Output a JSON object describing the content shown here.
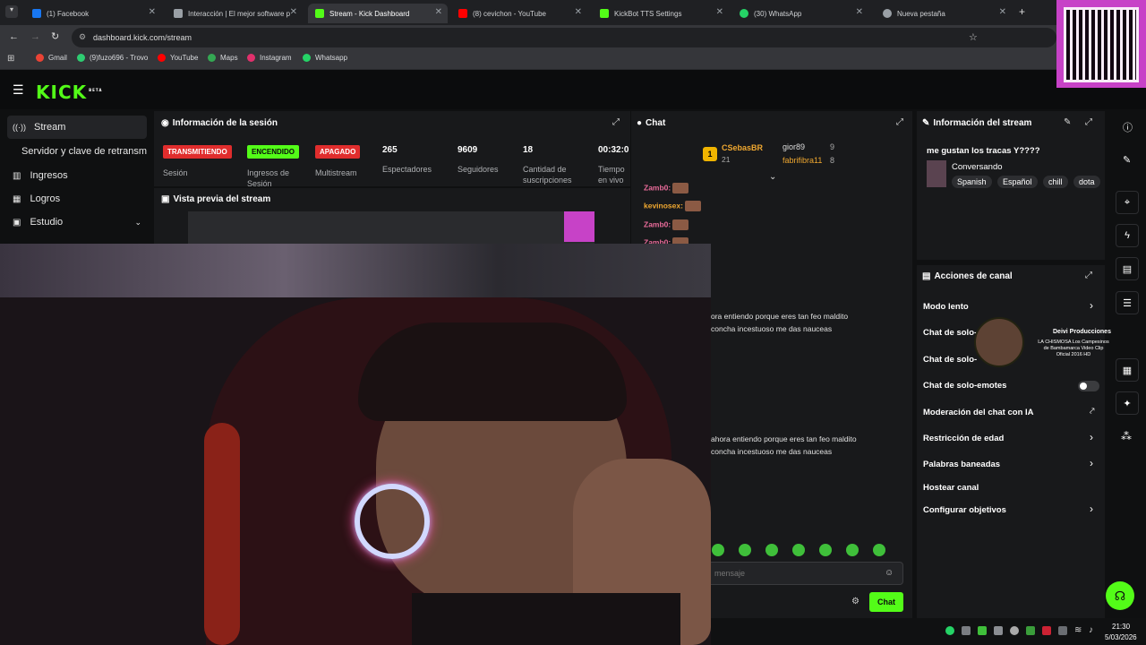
{
  "browser": {
    "tabs": [
      {
        "label": "(1) Facebook",
        "color": "#1877f2"
      },
      {
        "label": "Interacción | El mejor software p",
        "color": "#9aa0a6"
      },
      {
        "label": "Stream - Kick Dashboard",
        "color": "#53fc18"
      },
      {
        "label": "(8) cevichon - YouTube",
        "color": "#ff0000"
      },
      {
        "label": "KickBot TTS Settings",
        "color": "#53fc18"
      },
      {
        "label": "(30) WhatsApp",
        "color": "#25d366"
      },
      {
        "label": "Nueva pestaña",
        "color": "#9aa0a6"
      }
    ],
    "url": "dashboard.kick.com/stream",
    "bookmarks": [
      {
        "label": "Gmail",
        "color": "#ea4335"
      },
      {
        "label": "(9)fuzo696 - Trovo",
        "color": "#2ecc71"
      },
      {
        "label": "YouTube",
        "color": "#ff0000"
      },
      {
        "label": "Maps",
        "color": "#34a853"
      },
      {
        "label": "Instagram",
        "color": "#e1306c"
      },
      {
        "label": "Whatsapp",
        "color": "#25d366"
      }
    ]
  },
  "kick": {
    "logo": "KICK",
    "logo_badge": "BETA",
    "sidebar": [
      {
        "label": "Stream"
      },
      {
        "label": "Servidor y clave de retransm"
      },
      {
        "label": "Ingresos"
      },
      {
        "label": "Logros"
      },
      {
        "label": "Estudio"
      }
    ],
    "session": {
      "title": "Información de la sesión",
      "chips": [
        {
          "label": "TRANSMITIENDO",
          "caption": "Sesión"
        },
        {
          "label": "ENCENDIDO",
          "caption": "Ingresos de Sesión"
        },
        {
          "label": "APAGADO",
          "caption": "Multistream"
        }
      ],
      "stats": [
        {
          "value": "265",
          "label": "Espectadores"
        },
        {
          "value": "9609",
          "label": "Seguidores"
        },
        {
          "value": "18",
          "label": "Cantidad de suscripciones"
        },
        {
          "value": "00:32:0",
          "label": "Tiempo en vivo"
        }
      ]
    },
    "preview_title": "Vista previa del stream",
    "chat": {
      "title": "Chat",
      "top_user": "CSebasBR",
      "top_rank": "1",
      "top_count": "21",
      "other_users": [
        {
          "name": "gior89",
          "count": "9"
        },
        {
          "name": "fabrifibra11",
          "count": "8"
        }
      ],
      "messages": [
        {
          "user": "Zamb0:",
          "text": ""
        },
        {
          "user": "kevinosex:",
          "text": ""
        },
        {
          "user": "Zamb0:",
          "text": ""
        },
        {
          "user": "Zamb0:",
          "text": ""
        }
      ],
      "overlay_lines": [
        "ora entiendo porque eres tan feo maldito",
        "concha incestuoso me das nauceas",
        "ahora entiendo porque eres tan feo maldito",
        "concha incestuoso me das nauceas"
      ],
      "input_placeholder": "mensaje",
      "send_label": "Chat"
    },
    "stream_info": {
      "title": "Información del stream",
      "stream_title": "me gustan los tracas Y????",
      "category": "Conversando",
      "tags": [
        "Spanish",
        "Español",
        "chill",
        "dota"
      ]
    },
    "channel_actions": {
      "title": "Acciones de canal",
      "items": [
        {
          "label": "Modo lento"
        },
        {
          "label": "Chat de solo-"
        },
        {
          "label": "Chat de solo-"
        },
        {
          "label": "Chat de solo-emotes"
        },
        {
          "label": "Moderación del chat con IA"
        },
        {
          "label": "Restricción de edad"
        },
        {
          "label": "Palabras baneadas"
        },
        {
          "label": "Hostear canal"
        },
        {
          "label": "Configurar objetivos"
        }
      ]
    },
    "music_popup": {
      "channel": "Deivi Producciones",
      "song": "LA CHISMOSA Los Campesinos de Bambamarca Video Clip Oficial 2016 HD"
    }
  },
  "taskbar": {
    "time": "21:30",
    "date": "5/03/2026"
  }
}
